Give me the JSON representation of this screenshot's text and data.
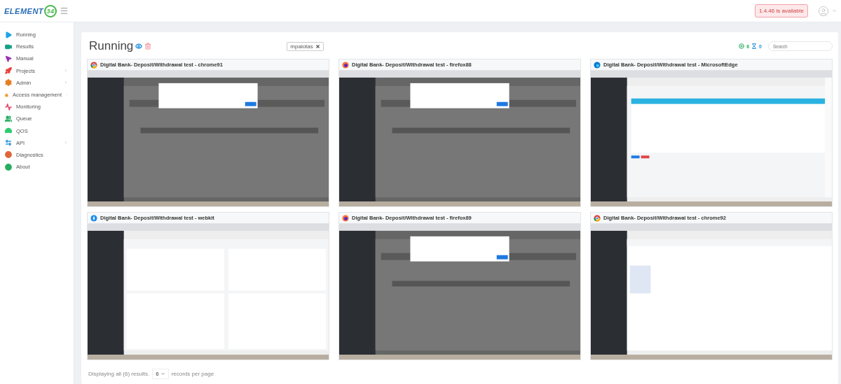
{
  "header": {
    "logo": {
      "text": "ELEMENT",
      "mark": "34"
    },
    "update_badge": "1.4.46 is available"
  },
  "sidebar": {
    "items": [
      {
        "label": "Running",
        "color": "#1ea7e1",
        "expandable": false
      },
      {
        "label": "Results",
        "color": "#16a085",
        "expandable": false
      },
      {
        "label": "Manual",
        "color": "#9b2fae",
        "expandable": false
      },
      {
        "label": "Projects",
        "color": "#e8413c",
        "expandable": true
      },
      {
        "label": "Admin",
        "color": "#e67e22",
        "expandable": true
      },
      {
        "label": "Access management",
        "color": "#f39c32",
        "expandable": true
      },
      {
        "label": "Monitoring",
        "color": "#e84b6b",
        "expandable": false
      },
      {
        "label": "Queue",
        "color": "#27ae60",
        "expandable": false
      },
      {
        "label": "QOS",
        "color": "#2ecc71",
        "expandable": false
      },
      {
        "label": "API",
        "color": "#3498db",
        "expandable": true
      },
      {
        "label": "Diagnostics",
        "color": "#e0663a",
        "expandable": false
      },
      {
        "label": "About",
        "color": "#27ae60",
        "expandable": false
      }
    ]
  },
  "main": {
    "title": "Running",
    "filter_chip": "mpalotas",
    "running_count": "6",
    "queued_count": "0",
    "search": {
      "placeholder": "Search"
    },
    "sessions": [
      {
        "title": "Digital Bank- Deposit/Withdrawal test - chrome91",
        "kind": "dialog"
      },
      {
        "title": "Digital Bank- Deposit/Withdrawal test - firefox88",
        "kind": "dialog"
      },
      {
        "title": "Digital Bank- Deposit/Withdrawal test - MicrosoftEdge",
        "kind": "form"
      },
      {
        "title": "Digital Bank- Deposit/Withdrawal test - webkit",
        "kind": "dashboard"
      },
      {
        "title": "Digital Bank- Deposit/Withdrawal test - firefox89",
        "kind": "dialog"
      },
      {
        "title": "Digital Bank- Deposit/Withdrawal test - chrome92",
        "kind": "blank"
      }
    ],
    "footer": {
      "summary": "Displaying all (6) results.",
      "page_size": "6",
      "suffix": "records per page"
    }
  }
}
